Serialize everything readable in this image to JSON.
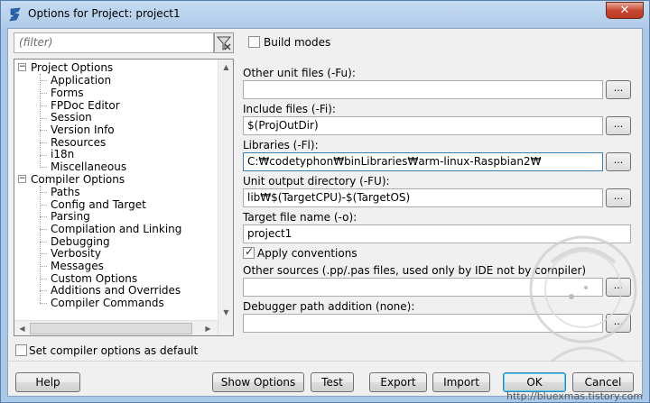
{
  "window": {
    "title": "Options for Project: project1",
    "close_label": "✕"
  },
  "filter": {
    "placeholder": "(filter)"
  },
  "build_modes": {
    "label": "Build modes",
    "checked": false
  },
  "tree": {
    "groups": [
      {
        "label": "Project Options",
        "children": [
          "Application",
          "Forms",
          "FPDoc Editor",
          "Session",
          "Version Info",
          "Resources",
          "i18n",
          "Miscellaneous"
        ]
      },
      {
        "label": "Compiler Options",
        "children": [
          "Paths",
          "Config and Target",
          "Parsing",
          "Compilation and Linking",
          "Debugging",
          "Verbosity",
          "Messages",
          "Custom Options",
          "Additions and Overrides",
          "Compiler Commands"
        ]
      }
    ]
  },
  "set_default": {
    "label": "Set compiler options as default",
    "checked": false
  },
  "fields": {
    "other_unit_files": {
      "label": "Other unit files (-Fu):",
      "value": ""
    },
    "include_files": {
      "label": "Include files (-Fi):",
      "value": "$(ProjOutDir)"
    },
    "libraries": {
      "label": "Libraries (-Fl):",
      "value": "C:₩codetyphon₩binLibraries₩arm-linux-Raspbian2₩"
    },
    "unit_output_dir": {
      "label": "Unit output directory (-FU):",
      "value": "lib₩$(TargetCPU)-$(TargetOS)"
    },
    "target_file_name": {
      "label": "Target file name (-o):",
      "value": "project1"
    },
    "apply_conventions": {
      "label": "Apply conventions",
      "checked": true
    },
    "other_sources": {
      "label": "Other sources (.pp/.pas files, used only by IDE not by compiler)",
      "value": ""
    },
    "debugger_path": {
      "label": "Debugger path addition (none):",
      "value": ""
    }
  },
  "dots_label": "...",
  "buttons": {
    "help": "Help",
    "show_options": "Show Options",
    "test": "Test",
    "export": "Export",
    "import": "Import",
    "ok": "OK",
    "cancel": "Cancel"
  },
  "watermark": {
    "url": "http://bluexmas.tistory.com"
  }
}
